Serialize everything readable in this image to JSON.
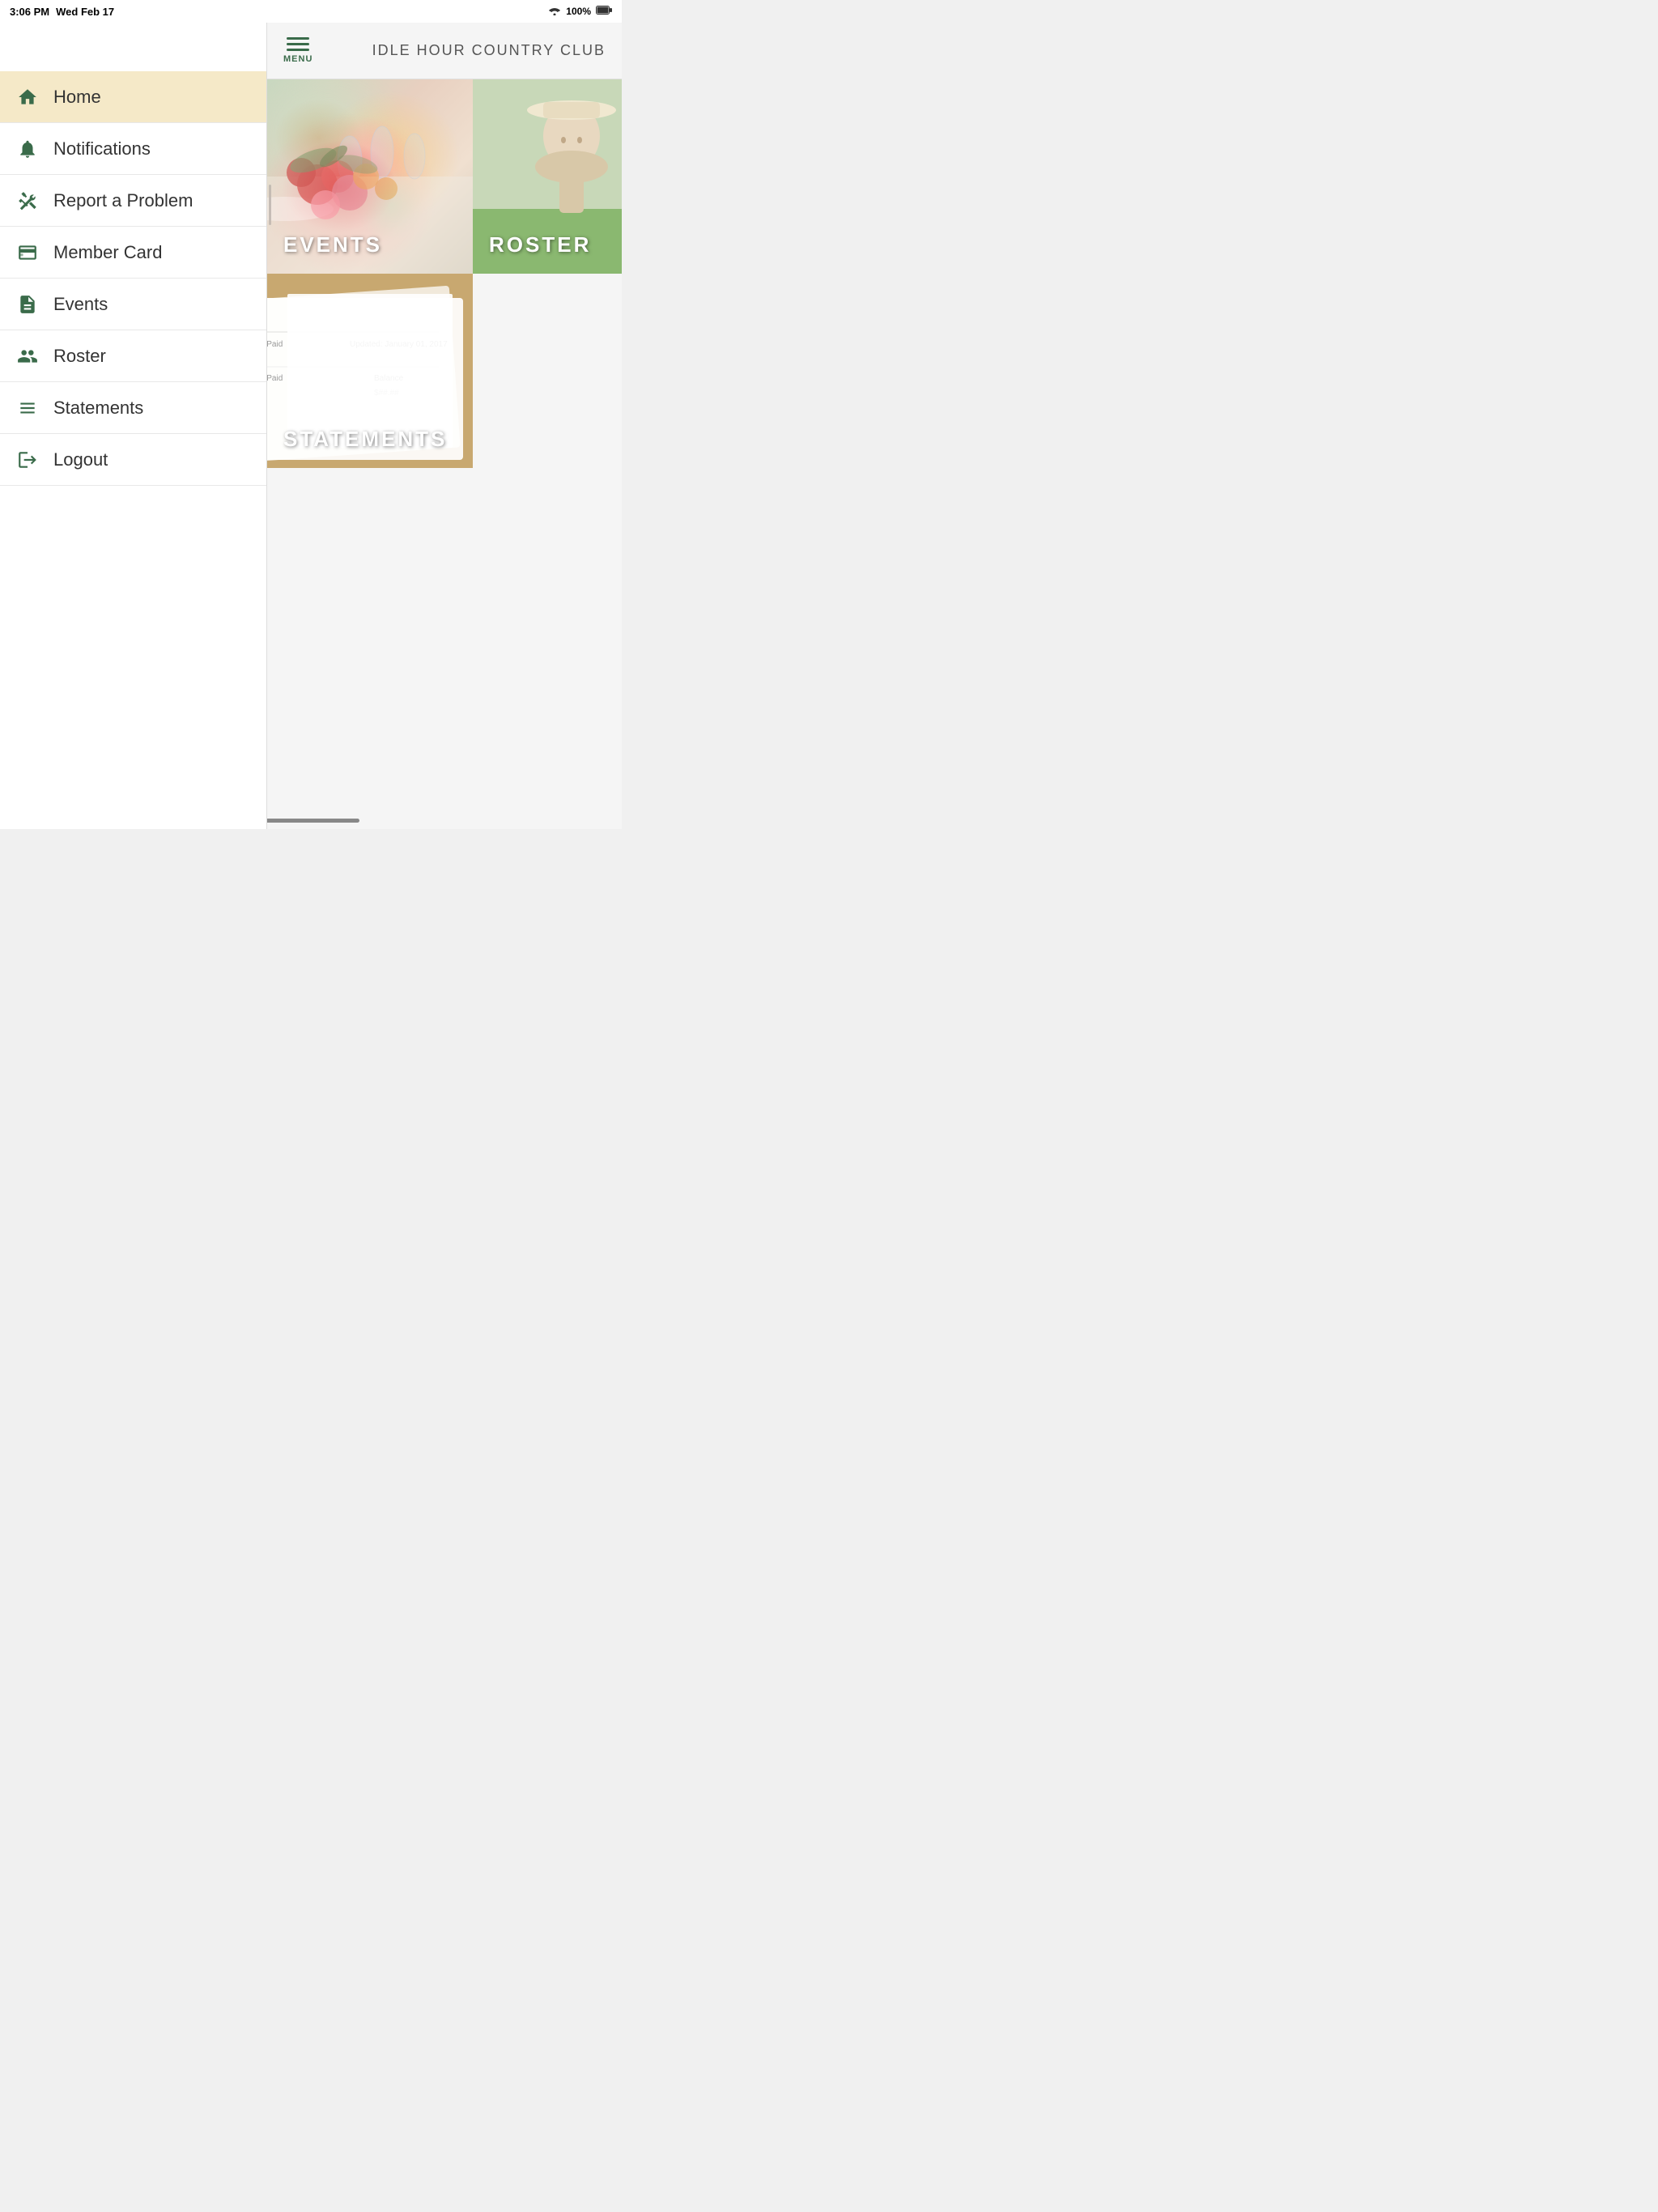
{
  "statusBar": {
    "time": "3:06 PM",
    "date": "Wed Feb 17",
    "battery": "100%",
    "wifi": true
  },
  "header": {
    "menuLabel": "MENU",
    "clubTitle": "IDLE HOUR COUNTRY CLUB"
  },
  "sidebar": {
    "items": [
      {
        "id": "home",
        "label": "Home",
        "icon": "home",
        "active": true
      },
      {
        "id": "notifications",
        "label": "Notifications",
        "icon": "bell",
        "active": false
      },
      {
        "id": "report",
        "label": "Report a Problem",
        "icon": "wrench",
        "active": false
      },
      {
        "id": "member-card",
        "label": "Member Card",
        "icon": "card",
        "active": false
      },
      {
        "id": "events",
        "label": "Events",
        "icon": "doc",
        "active": false
      },
      {
        "id": "roster",
        "label": "Roster",
        "icon": "people",
        "active": false
      },
      {
        "id": "statements",
        "label": "Statements",
        "icon": "list",
        "active": false
      },
      {
        "id": "logout",
        "label": "Logout",
        "icon": "logout",
        "active": false
      }
    ]
  },
  "tiles": [
    {
      "id": "events",
      "label": "EVENTS",
      "type": "events"
    },
    {
      "id": "roster",
      "label": "ROSTER",
      "type": "roster"
    },
    {
      "id": "statements",
      "label": "STATEMENTS",
      "type": "statements"
    }
  ],
  "colors": {
    "accent": "#3a6b4a",
    "activeBackground": "#f5e9c8",
    "sidebar": "#ffffff"
  }
}
